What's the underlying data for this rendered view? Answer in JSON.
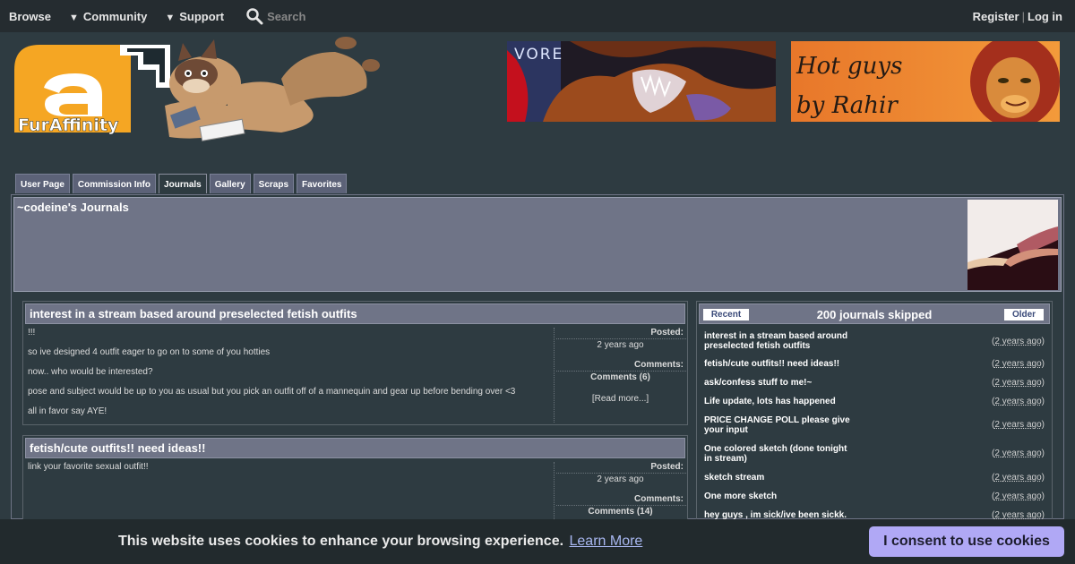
{
  "nav": {
    "browse": "Browse",
    "community": "Community",
    "support": "Support",
    "search_placeholder": "Search",
    "register": "Register",
    "separator": "|",
    "login": "Log in"
  },
  "logo": {
    "text": "FurAffinity",
    "mark": "a"
  },
  "banners": [
    {
      "text": "VORE"
    },
    {
      "line1": "Hot guys",
      "line2": "by Rahir"
    }
  ],
  "tabs": [
    "User Page",
    "Commission Info",
    "Journals",
    "Gallery",
    "Scraps",
    "Favorites"
  ],
  "profile": {
    "title": "~codeine's Journals"
  },
  "journals": [
    {
      "title": "interest in a stream based around preselected fetish outfits",
      "body": [
        "!!!",
        "so ive designed 4 outfit eager to go on to some of you hotties",
        "now.. who would be interested?",
        "pose and subject would be up to you as usual but you pick an outfit off of a mannequin and gear up before bending over <3",
        "all in favor say AYE!"
      ],
      "posted_label": "Posted:",
      "posted_value": "2 years ago",
      "comments_label": "Comments:",
      "comments_value": "Comments (6)",
      "read_more": "[Read more...]"
    },
    {
      "title": "fetish/cute outfits!! need ideas!!",
      "body": [
        "link your favorite sexual outfit!!"
      ],
      "posted_label": "Posted:",
      "posted_value": "2 years ago",
      "comments_label": "Comments:",
      "comments_value": "Comments (14)"
    }
  ],
  "side": {
    "recent": "Recent",
    "caption": "200 journals skipped",
    "older": "Older",
    "items": [
      {
        "title": "interest in a stream based around preselected fetish outfits",
        "date": "2 years ago"
      },
      {
        "title": "fetish/cute outfits!! need ideas!!",
        "date": "2 years ago"
      },
      {
        "title": "ask/confess stuff to me!~",
        "date": "2 years ago"
      },
      {
        "title": "Life update, lots has happened",
        "date": "2 years ago"
      },
      {
        "title": "PRICE CHANGE POLL please give your input",
        "date": "2 years ago"
      },
      {
        "title": "One colored sketch (done tonight in stream)",
        "date": "2 years ago"
      },
      {
        "title": "sketch stream",
        "date": "2 years ago"
      },
      {
        "title": "One more sketch",
        "date": "2 years ago"
      },
      {
        "title": "hey guys , im sick/ive been sickk.",
        "date": "2 years ago"
      }
    ]
  },
  "cookie": {
    "message": "This website uses cookies to enhance your browsing experience.",
    "learn_more": "Learn More",
    "consent": "I consent to use cookies"
  },
  "colors": {
    "accent": "#f5a623",
    "panel": "#6f7487",
    "background": "#2e3b41",
    "consent": "#b0a8f5"
  }
}
